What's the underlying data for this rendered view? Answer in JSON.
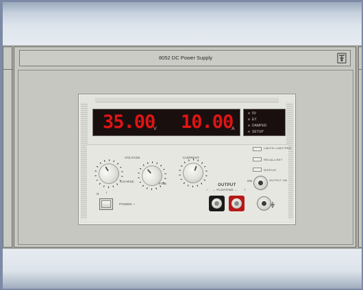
{
  "panel": {
    "title": "8052 DC Power Supply"
  },
  "display": {
    "voltage": "35.00",
    "voltage_unit": "V",
    "current": "10.00",
    "current_unit": "A"
  },
  "indicators": [
    {
      "label": "5V"
    },
    {
      "label": "EY"
    },
    {
      "label": "DAMPED"
    },
    {
      "label": "SETUP"
    }
  ],
  "controls": {
    "voltage_label": "VOLTAGE",
    "current_label": "CURRENT",
    "coarse_label": "COARSE",
    "fine_label": "FINE",
    "power_label": "POWER ~",
    "output_label": "OUTPUT",
    "output_sub": "→ FLOATING ←",
    "minus_sign": "−",
    "plus_sign": "+",
    "on_label": "ON",
    "off_label": "O",
    "i_label": "I",
    "side_buttons": [
      {
        "label": "LIMITS/ LIMIT/PRO"
      },
      {
        "label": "RECALL/SET"
      },
      {
        "label": "DISPLAY"
      },
      {
        "label": "OUTPUT ON"
      }
    ]
  },
  "colors": {
    "segment_red": "#e01414",
    "rack_grey": "#a9aaa4",
    "panel_beige": "#e3e4de"
  },
  "icons": [
    "tf-logo-icon",
    "ground-terminal-icon",
    "power-switch-icon"
  ]
}
